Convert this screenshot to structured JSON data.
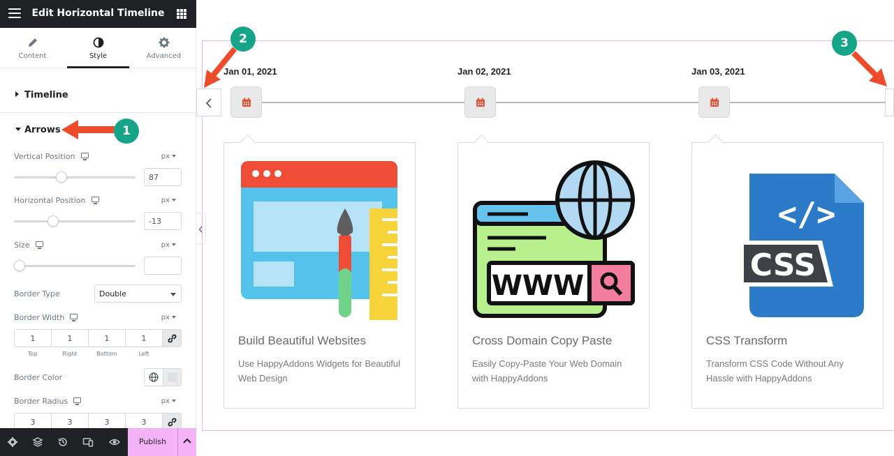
{
  "editor": {
    "title": "Edit Horizontal Timeline",
    "tabs": [
      {
        "label": "Content",
        "icon": "pencil-icon"
      },
      {
        "label": "Style",
        "icon": "half-circle-icon",
        "active": true
      },
      {
        "label": "Advanced",
        "icon": "gear-icon"
      }
    ],
    "sections": {
      "timeline": "Timeline",
      "arrows": "Arrows"
    },
    "controls": {
      "vertical_position": {
        "label": "Vertical Position",
        "unit": "px",
        "value": "87",
        "slider_fraction": 0.39
      },
      "horizontal_position": {
        "label": "Horizontal Position",
        "unit": "px",
        "value": "-13",
        "slider_fraction": 0.32
      },
      "size": {
        "label": "Size",
        "unit": "px",
        "value": "",
        "slider_fraction": 0.0
      },
      "border_type": {
        "label": "Border Type",
        "value": "Double"
      },
      "border_width": {
        "label": "Border Width",
        "unit": "px",
        "values": [
          "1",
          "1",
          "1",
          "1"
        ],
        "captions": [
          "Top",
          "Right",
          "Bottom",
          "Left"
        ]
      },
      "border_color": {
        "label": "Border Color"
      },
      "border_radius": {
        "label": "Border Radius",
        "unit": "px",
        "values": [
          "3",
          "3",
          "3",
          "3"
        ]
      }
    },
    "footer": {
      "publish": "Publish"
    }
  },
  "callouts": [
    "1",
    "2",
    "3"
  ],
  "accent_colors": {
    "callout": "#17a589",
    "arrow": "#ec4b2c",
    "publish": "#f3b3f6",
    "frame": "#e7b4ea"
  },
  "timeline": {
    "items": [
      {
        "date": "Jan 01, 2021",
        "title": "Build Beautiful Websites",
        "desc": "Use HappyAddons Widgets for Beautiful Web Design",
        "art": "web-design-illustration"
      },
      {
        "date": "Jan 02, 2021",
        "title": "Cross Domain Copy Paste",
        "desc": "Easily Copy-Paste Your Web Domain with HappyAddons",
        "art": "www-domain-illustration",
        "art_text": "WWW"
      },
      {
        "date": "Jan 03, 2021",
        "title": "CSS Transform",
        "desc": "Transform CSS Code Without Any Hassle with HappyAddons",
        "art": "css-file-illustration",
        "art_text": "CSS",
        "art_code": "</>"
      }
    ]
  }
}
